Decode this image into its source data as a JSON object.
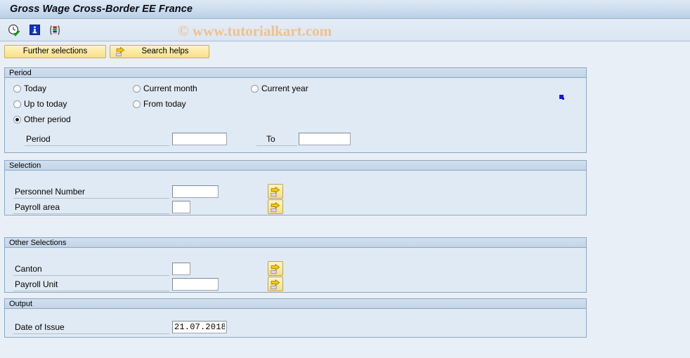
{
  "window": {
    "title": "Gross Wage Cross-Border EE France"
  },
  "watermark": {
    "text": "© www.tutorialkart.com"
  },
  "toolbar": {
    "icons": [
      {
        "name": "execute-clock-icon",
        "title": "Execute"
      },
      {
        "name": "info-icon",
        "title": "Information"
      },
      {
        "name": "variant-bars-icon",
        "title": "Get Variant"
      }
    ]
  },
  "buttons": {
    "further_selections": "Further selections",
    "search_helps": "Search helps"
  },
  "period": {
    "header": "Period",
    "options": [
      {
        "label": "Today",
        "selected": false
      },
      {
        "label": "Current month",
        "selected": false
      },
      {
        "label": "Current year",
        "selected": false
      },
      {
        "label": "Up to today",
        "selected": false
      },
      {
        "label": "From today",
        "selected": false
      },
      {
        "label": "Other period",
        "selected": true
      }
    ],
    "period_label": "Period",
    "period_value": "",
    "to_label": "To",
    "to_value": ""
  },
  "selection": {
    "header": "Selection",
    "rows": [
      {
        "label": "Personnel Number",
        "value": ""
      },
      {
        "label": "Payroll area",
        "value": ""
      }
    ],
    "multi_select_icon": "multi-selection-arrow-icon"
  },
  "other_selections": {
    "header": "Other Selections",
    "rows": [
      {
        "label": "Canton",
        "value": ""
      },
      {
        "label": "Payroll Unit",
        "value": ""
      }
    ],
    "multi_select_icon": "multi-selection-arrow-icon"
  },
  "output": {
    "header": "Output",
    "date_label": "Date of Issue",
    "date_value": "21.07.2018"
  },
  "colors": {
    "title_bar": "#cfdff0",
    "panel_bg": "#e0eaf4",
    "panel_border": "#8ba7c2",
    "button_yellow": "#fbeaa0",
    "watermark": "#f2c08a",
    "page_bg": "#e9eff7"
  }
}
